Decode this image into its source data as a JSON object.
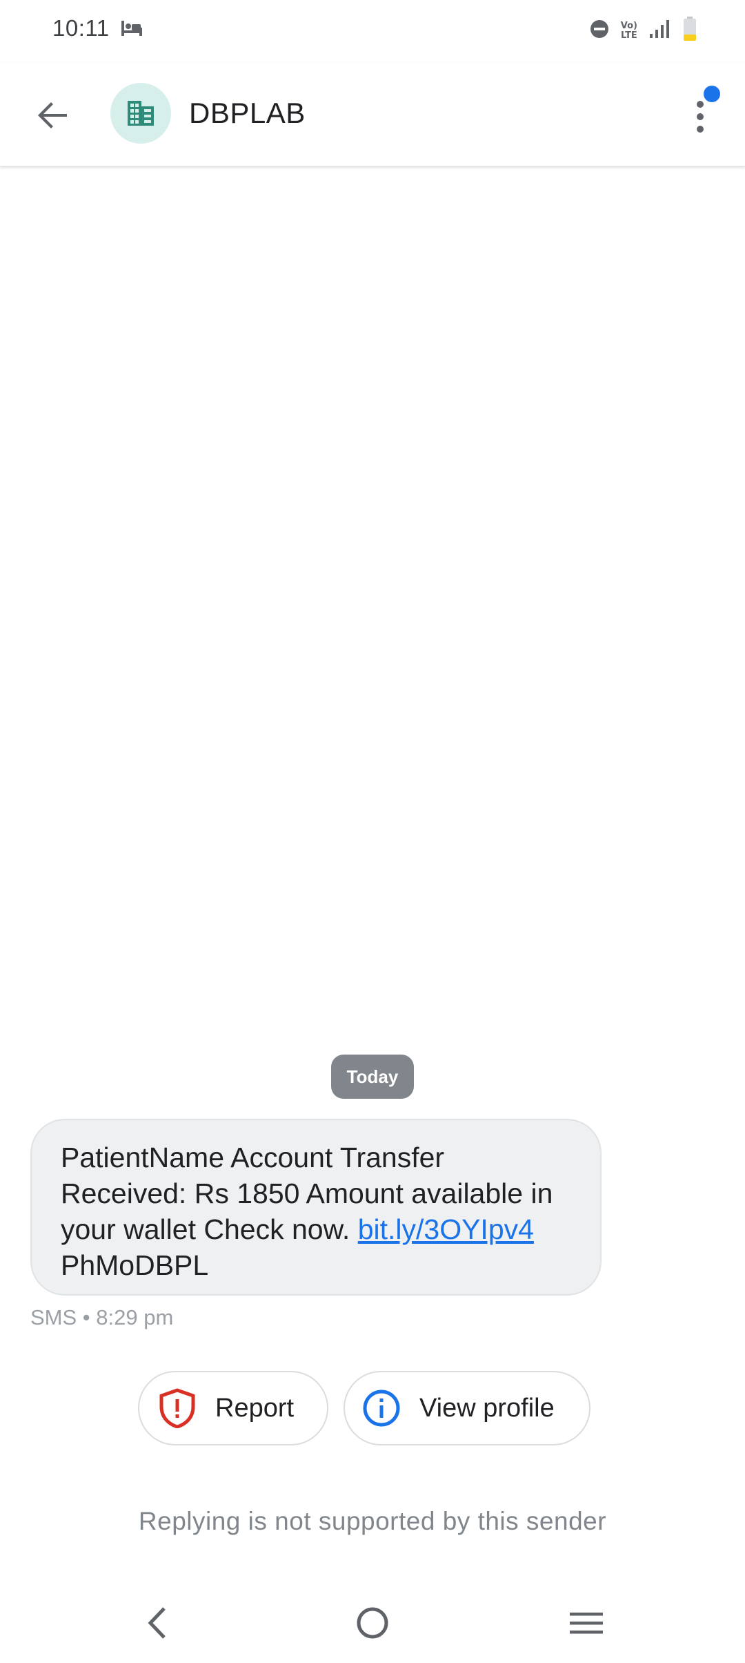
{
  "status_bar": {
    "time": "10:11",
    "icons": [
      "bed-icon",
      "do-not-disturb-icon",
      "volte-icon",
      "signal-icon",
      "battery-icon"
    ],
    "volte_top": "Vo)",
    "volte_bottom": "LTE",
    "battery_color": "#f9ce1d"
  },
  "header": {
    "contact_name": "DBPLAB",
    "avatar_icon": "building-icon",
    "avatar_bg": "#d6efeb",
    "avatar_fg": "#2e8b7a",
    "back_icon": "arrow-back-icon",
    "more_icon": "more-vert-icon",
    "badge_color": "#1a73e8"
  },
  "conversation": {
    "date_label": "Today",
    "message": {
      "text_before": "PatientName Account Transfer Received: Rs 1850 Amount available in your wallet Check now. ",
      "link": "bit.ly/3OYIpv4",
      "text_after": " PhMoDBPL",
      "meta": "SMS • 8:29 pm"
    }
  },
  "actions": {
    "report_label": "Report",
    "report_color": "#d93025",
    "view_profile_label": "View profile",
    "view_profile_color": "#1a73e8"
  },
  "footer": {
    "reply_note": "Replying is not supported by this sender"
  },
  "nav_bar": {
    "icons": [
      "nav-back-icon",
      "nav-home-icon",
      "nav-recents-icon"
    ]
  }
}
